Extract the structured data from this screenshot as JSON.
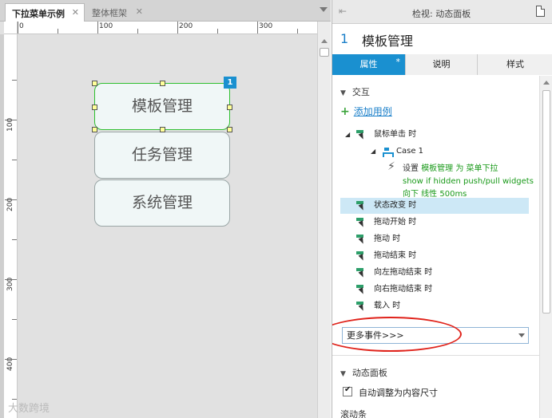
{
  "editor": {
    "tabs": [
      {
        "label": "下拉菜单示例",
        "close": "✕"
      },
      {
        "label": "整体框架",
        "close": "✕"
      }
    ],
    "ruler_top": [
      "0",
      "100",
      "200",
      "300"
    ],
    "ruler_left": [
      "100",
      "200",
      "300",
      "400"
    ],
    "widgets": [
      {
        "label": "模板管理"
      },
      {
        "label": "任务管理"
      },
      {
        "label": "系统管理"
      }
    ],
    "badge": "1",
    "watermark": "大数跨境"
  },
  "inspector": {
    "header_title": "检视: 动态面板",
    "widget_number": "1",
    "widget_name": "模板管理",
    "tabs": [
      {
        "label": "属性",
        "marker": "*"
      },
      {
        "label": "说明"
      },
      {
        "label": "样式"
      }
    ],
    "interaction": {
      "section_title": "交互",
      "add_case": "添加用例",
      "events": [
        {
          "label": "鼠标单击 时"
        },
        {
          "label": "状态改变 时"
        },
        {
          "label": "拖动开始 时"
        },
        {
          "label": "拖动 时"
        },
        {
          "label": "拖动结束 时"
        },
        {
          "label": "向左拖动结束 时"
        },
        {
          "label": "向右拖动结束 时"
        },
        {
          "label": "载入 时"
        }
      ],
      "case_label": "Case 1",
      "action": {
        "prefix": "设置 ",
        "target": "模板管理 为 菜单下拉",
        "detail": "show if hidden push/pull widgets 向下 线性 500ms"
      },
      "more_events": "更多事件>>>"
    },
    "dynamic_panel": {
      "section_title": "动态面板",
      "auto_fit_label": "自动调整为内容尺寸",
      "auto_fit_checked": true
    },
    "scrollbars_title": "滚动条"
  }
}
